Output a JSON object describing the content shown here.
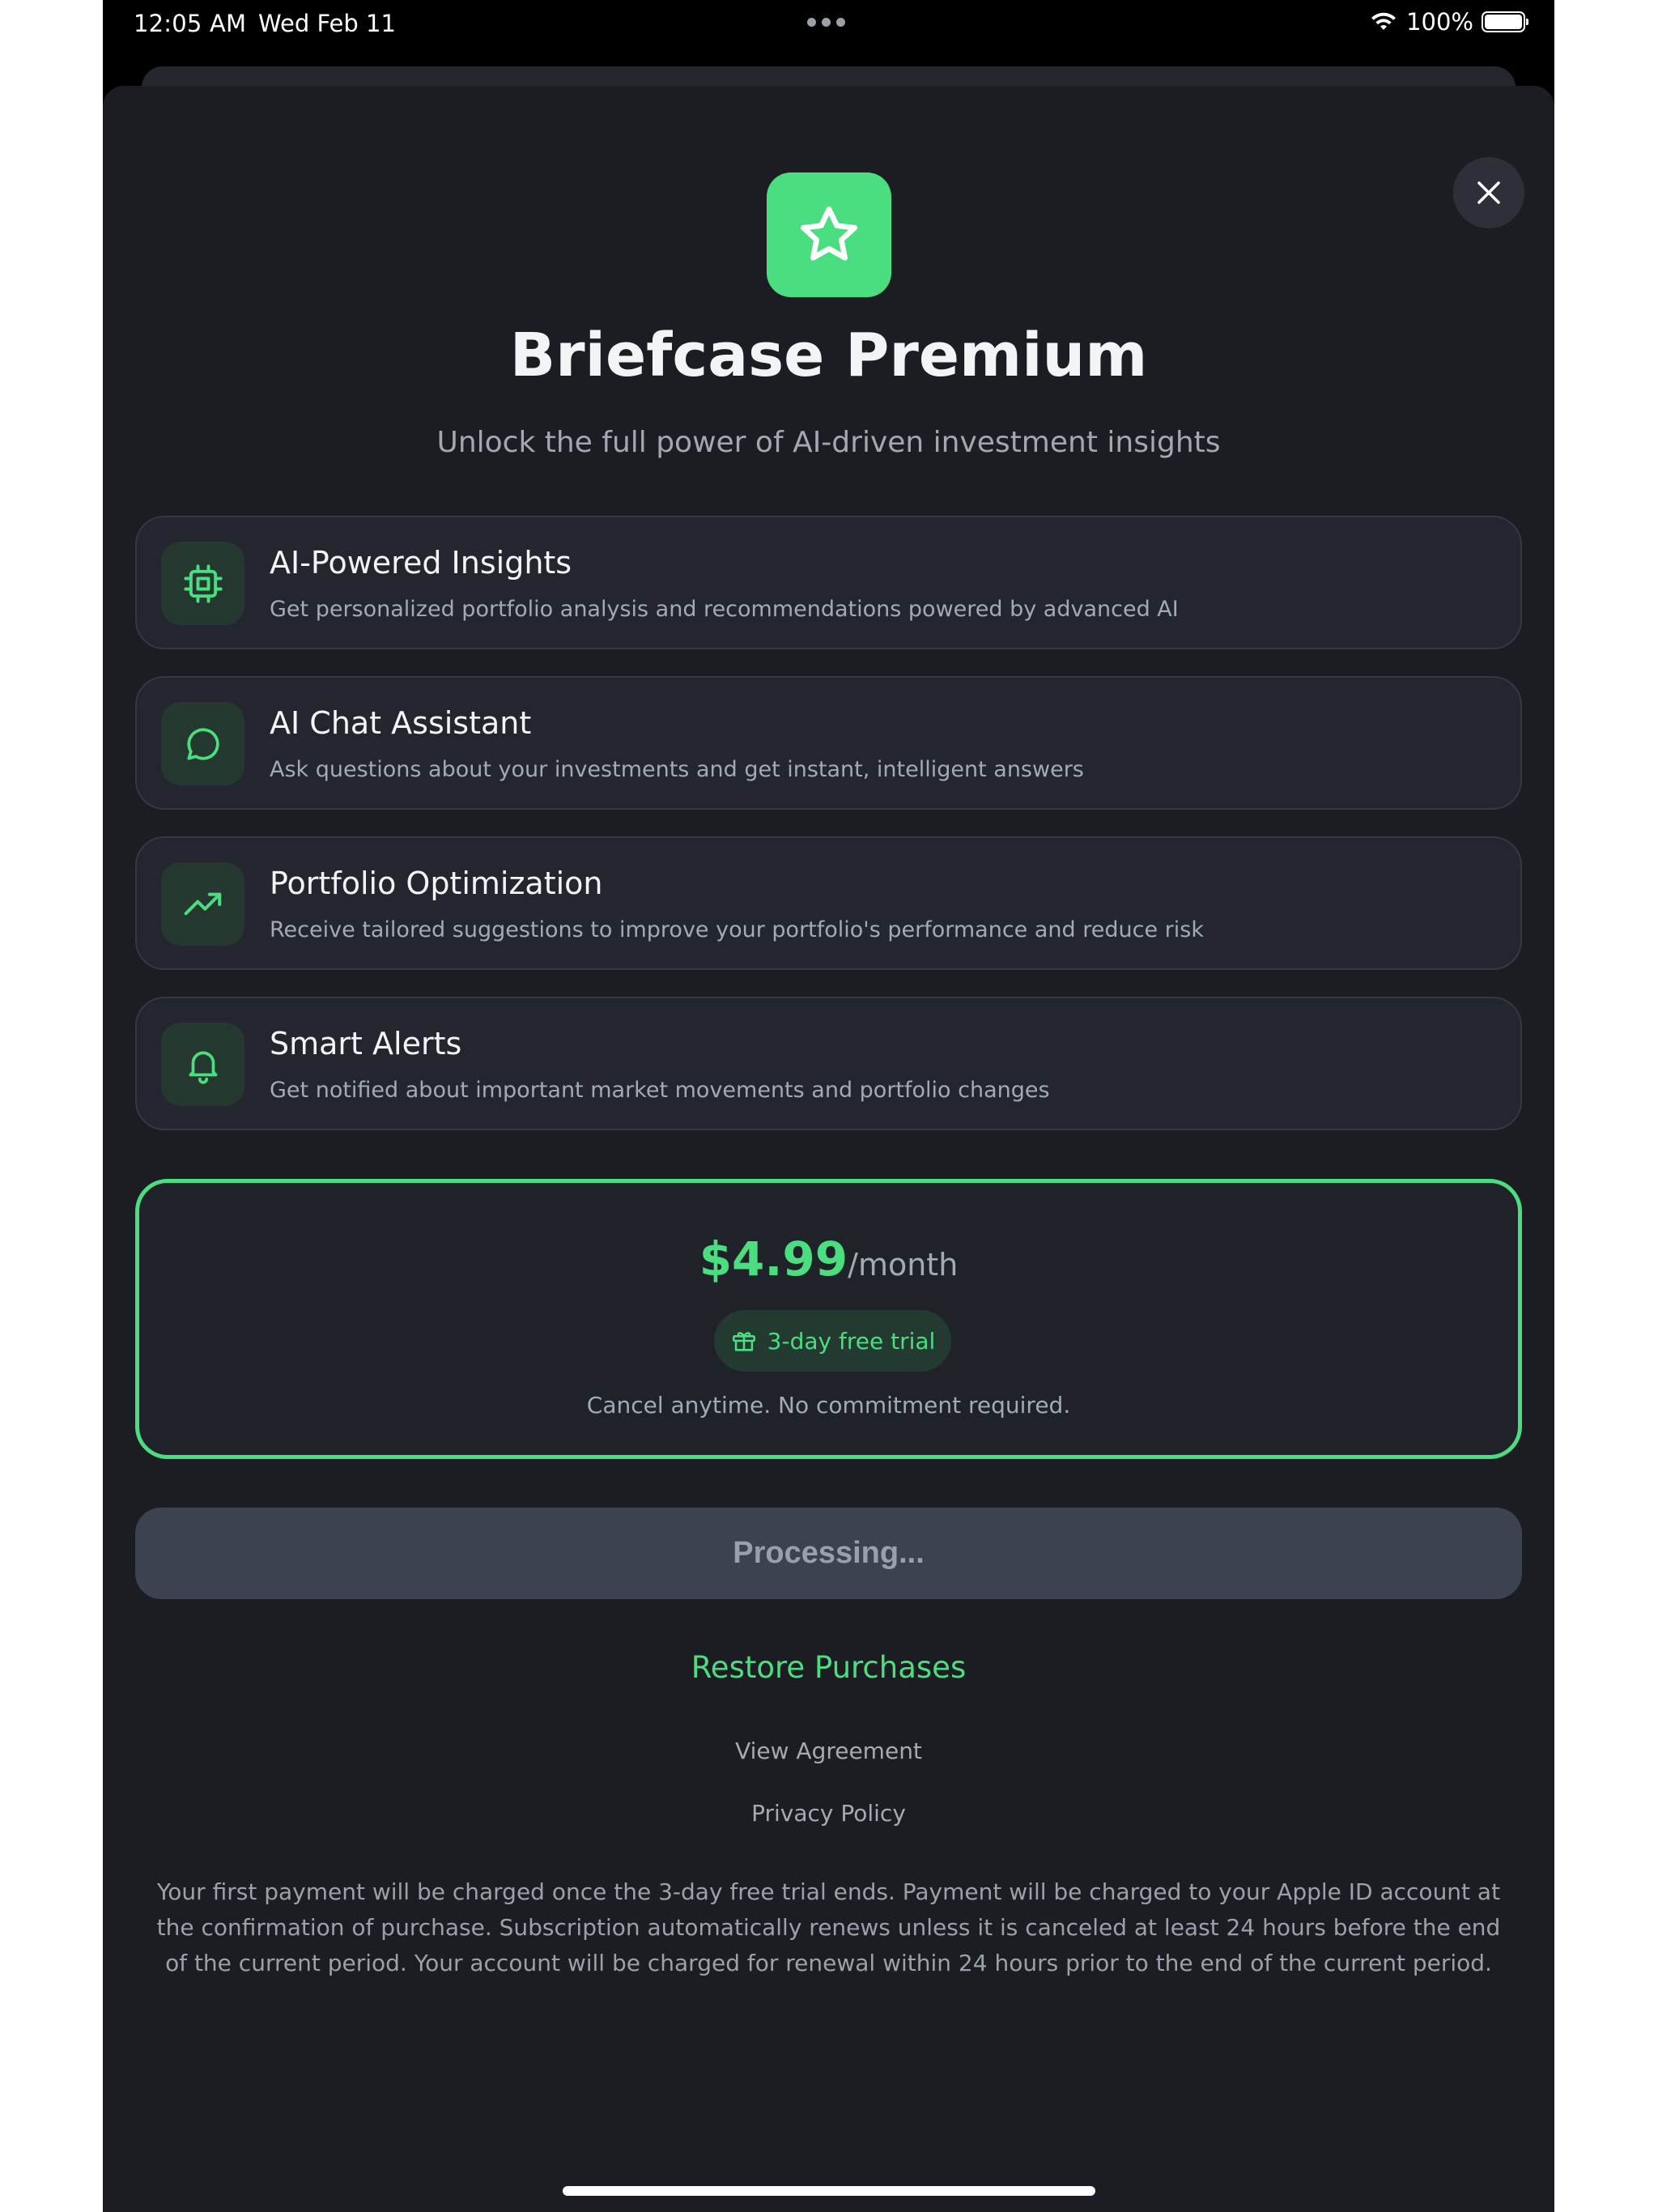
{
  "status_bar": {
    "time": "12:05 AM",
    "date": "Wed Feb 11",
    "battery": "100%"
  },
  "header": {
    "title": "Briefcase Premium",
    "subtitle": "Unlock the full power of AI-driven investment insights"
  },
  "features": [
    {
      "icon": "cpu-chip-icon",
      "title": "AI-Powered Insights",
      "description": "Get personalized portfolio analysis and recommendations powered by advanced AI"
    },
    {
      "icon": "chat-bubble-icon",
      "title": "AI Chat Assistant",
      "description": "Ask questions about your investments and get instant, intelligent answers"
    },
    {
      "icon": "trending-up-icon",
      "title": "Portfolio Optimization",
      "description": "Receive tailored suggestions to improve your portfolio's performance and reduce risk"
    },
    {
      "icon": "bell-icon",
      "title": "Smart Alerts",
      "description": "Get notified about important market movements and portfolio changes"
    }
  ],
  "pricing": {
    "amount": "$4.99",
    "period": "/month",
    "trial": "3-day free trial",
    "note": "Cancel anytime. No commitment required."
  },
  "actions": {
    "subscribe_label": "Processing...",
    "restore_label": "Restore Purchases",
    "agreement_label": "View Agreement",
    "privacy_label": "Privacy Policy"
  },
  "legal": "Your first payment will be charged once the 3-day free trial ends. Payment will be charged to your Apple ID account at the confirmation of purchase. Subscription automatically renews unless it is canceled at least 24 hours before the end of the current period. Your account will be charged for renewal within 24 hours prior to the end of the current period.",
  "colors": {
    "accent": "#4ade80",
    "background": "#1b1d23",
    "card": "#23262e",
    "button_disabled": "#3c4250"
  }
}
